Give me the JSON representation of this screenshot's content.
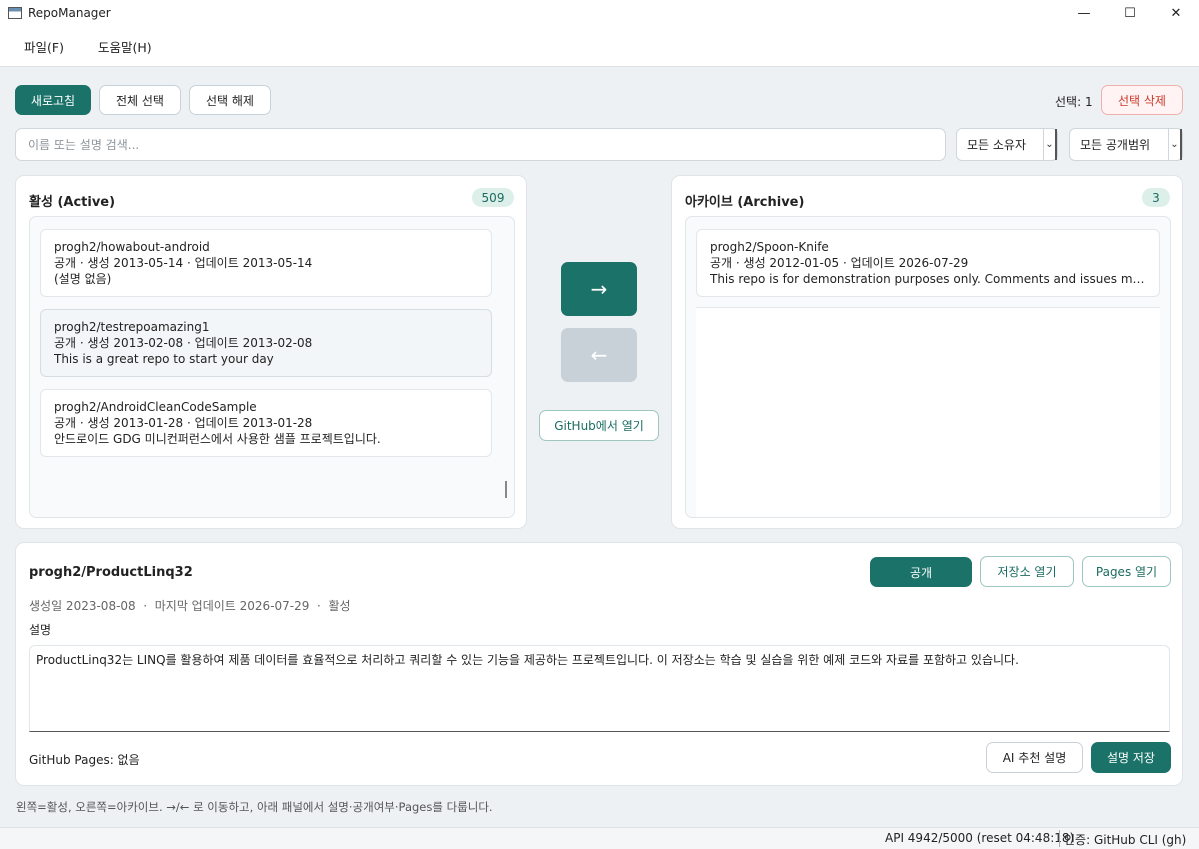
{
  "window": {
    "title": "RepoManager",
    "minimize_glyph": "—",
    "maximize_glyph": "☐",
    "close_glyph": "✕"
  },
  "menu": {
    "file": "파일(F)",
    "help": "도움말(H)"
  },
  "toolbar": {
    "refresh": "새로고침",
    "select_all": "전체 선택",
    "deselect": "선택 해제",
    "selection_count": "선택: 1",
    "delete_selected": "선택 삭제"
  },
  "filters": {
    "search_placeholder": "이름 또는 설명 검색...",
    "owner": "모든 소유자",
    "visibility": "모든 공개범위"
  },
  "active": {
    "title": "활성 (Active)",
    "count": "509",
    "items": [
      {
        "name": "progh2/howabout-android",
        "meta": "공개 · 생성 2013-05-14 · 업데이트 2013-05-14",
        "desc": "(설명 없음)"
      },
      {
        "name": "progh2/testrepoamazing1",
        "meta": "공개 · 생성 2013-02-08 · 업데이트 2013-02-08",
        "desc": "This is a great repo to start your day"
      },
      {
        "name": "progh2/AndroidCleanCodeSample",
        "meta": "공개 · 생성 2013-01-28 · 업데이트 2013-01-28",
        "desc": "안드로이드 GDG 미니컨퍼런스에서 사용한 샘플 프로젝트입니다."
      }
    ]
  },
  "archive": {
    "title": "아카이브 (Archive)",
    "count": "3",
    "items": [
      {
        "name": "progh2/Spoon-Knife",
        "meta": "공개 · 생성 2012-01-05 · 업데이트 2026-07-29",
        "desc": "This repo is for demonstration purposes only. Comments and issues may or may not be responded to."
      }
    ]
  },
  "transfer": {
    "to_archive": "→",
    "to_active": "←",
    "open_github": "GitHub에서 열기"
  },
  "detail": {
    "title": "progh2/ProductLinq32",
    "meta": "생성일 2023-08-08  ·  마지막 업데이트 2026-07-29  ·  활성",
    "visibility_button": "공개",
    "open_repo": "저장소 열기",
    "open_pages": "Pages 열기",
    "desc_label": "설명",
    "description": "ProductLinq32는 LINQ를 활용하여 제품 데이터를 효율적으로 처리하고 쿼리할 수 있는 기능을 제공하는 프로젝트입니다. 이 저장소는 학습 및 실습을 위한 예제 코드와 자료를 포함하고 있습니다.",
    "pages": "GitHub Pages: 없음",
    "ai_suggest": "AI 추천 설명",
    "save_desc": "설명 저장"
  },
  "hint": "왼쪽=활성, 오른쪽=아카이브. →/← 로 이동하고, 아래 패널에서 설명·공개여부·Pages를 다룹니다.",
  "status": {
    "api": "API 4942/5000 (reset 04:48:18)",
    "auth": "인증: GitHub CLI (gh)"
  },
  "colors": {
    "accent": "#1a7269",
    "danger": "#c93a2c",
    "disabled": "#c8d1d8"
  }
}
